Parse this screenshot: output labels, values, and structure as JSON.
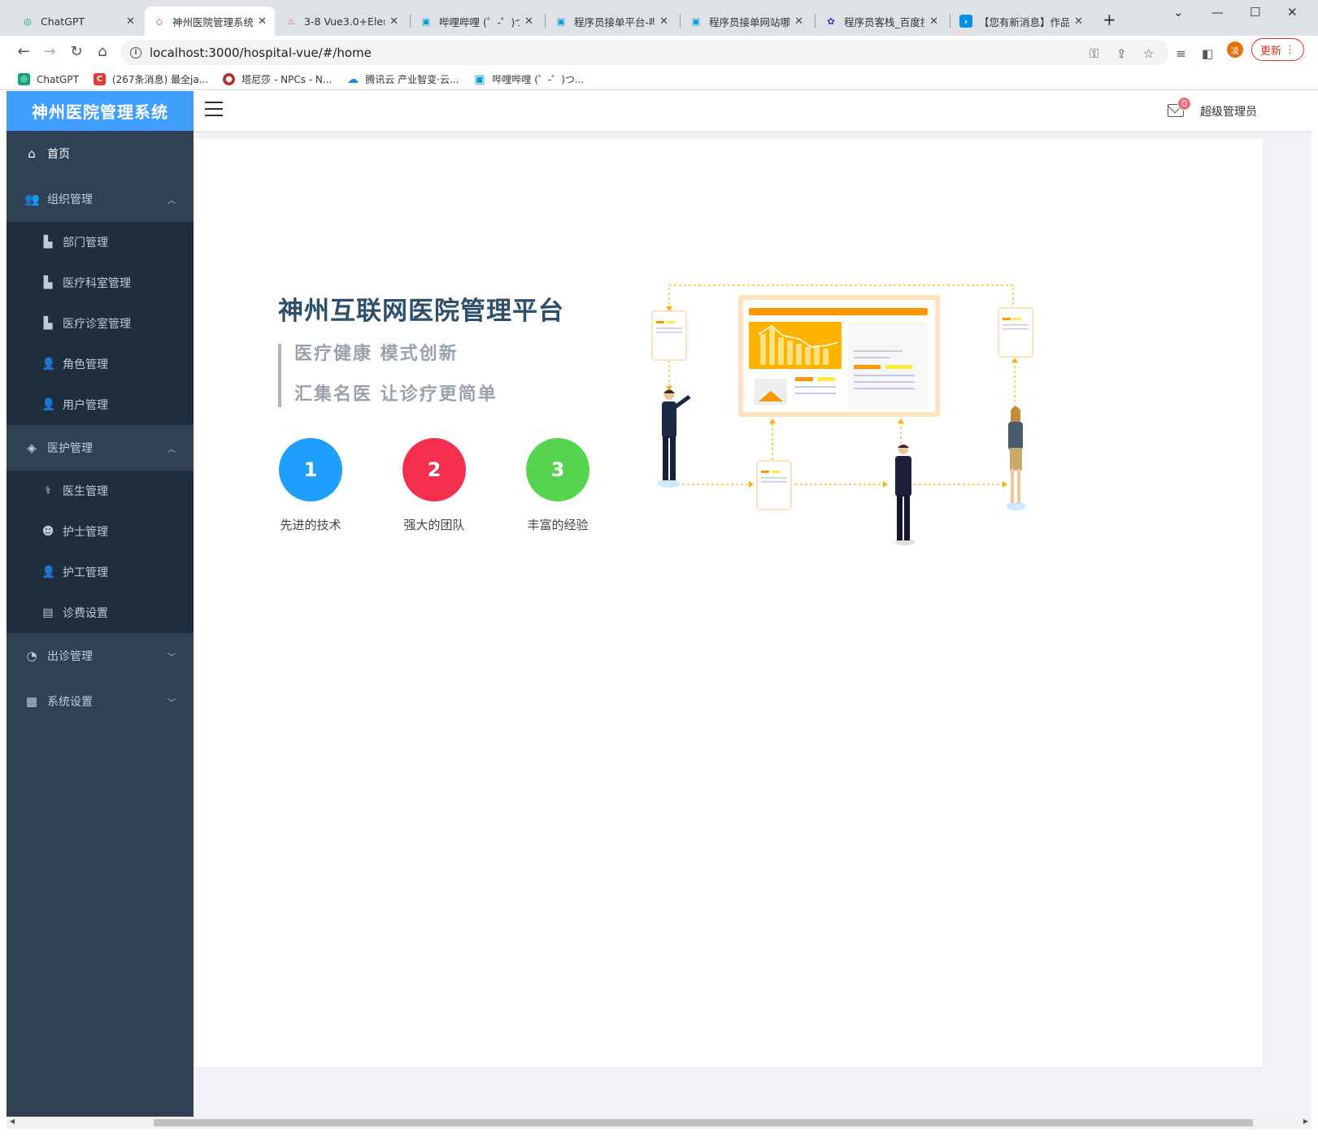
{
  "browser": {
    "tabs": [
      {
        "title": "ChatGPT",
        "icon": "chatgpt-icon",
        "color": "#10a37f",
        "glyph": "◎"
      },
      {
        "title": "神州医院管理系统",
        "icon": "vue-app-icon",
        "color": "#e53935",
        "glyph": "◇"
      },
      {
        "title": "3-8 Vue3.0+Elem",
        "icon": "flame-icon",
        "color": "#e53935",
        "glyph": "♨"
      },
      {
        "title": "哔哩哔哩 (゜-゜)つ",
        "icon": "bilibili-icon",
        "color": "#00a1d6",
        "glyph": "▣"
      },
      {
        "title": "程序员接单平台-哔",
        "icon": "bilibili-icon",
        "color": "#00a1d6",
        "glyph": "▣"
      },
      {
        "title": "程序员接单网站哪",
        "icon": "bilibili-icon",
        "color": "#00a1d6",
        "glyph": "▣"
      },
      {
        "title": "程序员客栈_百度搜",
        "icon": "baidu-icon",
        "color": "#2932e1",
        "glyph": "✿"
      },
      {
        "title": "【您有新消息】作品",
        "icon": "terminal-icon",
        "color": "#0091ea",
        "glyph": "›"
      }
    ],
    "url": "localhost:3000/hospital-vue/#/home",
    "profile_initial": "凌",
    "update_label": "更新",
    "bookmarks": [
      {
        "label": "ChatGPT",
        "color": "#10a37f",
        "glyph": "◎"
      },
      {
        "label": "(267条消息) 最全ja...",
        "color": "#e53935",
        "glyph": "C"
      },
      {
        "label": "塔尼莎 - NPCs - N...",
        "color": "#c62828",
        "glyph": "●"
      },
      {
        "label": "腾讯云 产业智变·云...",
        "color": "#1e88e5",
        "glyph": "☁"
      },
      {
        "label": "哔哩哔哩 (゜-゜)つ...",
        "color": "#00a1d6",
        "glyph": "▣"
      }
    ]
  },
  "app": {
    "logo": "神州医院管理系统",
    "header": {
      "badge_count": "0",
      "username": "超级管理员"
    },
    "menu": {
      "home": "首页",
      "org": "组织管理",
      "org_items": [
        "部门管理",
        "医疗科室管理",
        "医疗诊室管理",
        "角色管理",
        "用户管理"
      ],
      "care": "医护管理",
      "care_items": [
        "医生管理",
        "护士管理",
        "护工管理",
        "诊费设置"
      ],
      "visit": "出诊管理",
      "system": "系统设置"
    },
    "hero": {
      "title": "神州互联网医院管理平台",
      "slogan_1": "医疗健康  模式创新",
      "slogan_2": "汇集名医  让诊疗更简单",
      "features": [
        {
          "num": "1",
          "label": "先进的技术",
          "color": "#1e9fff"
        },
        {
          "num": "2",
          "label": "强大的团队",
          "color": "#f5304e"
        },
        {
          "num": "3",
          "label": "丰富的经验",
          "color": "#56d34f"
        }
      ]
    }
  },
  "colors": {
    "accent": "#409eff",
    "sidebar": "#304156",
    "submenu": "#1f2d3d",
    "illustration": "#ffb300"
  }
}
